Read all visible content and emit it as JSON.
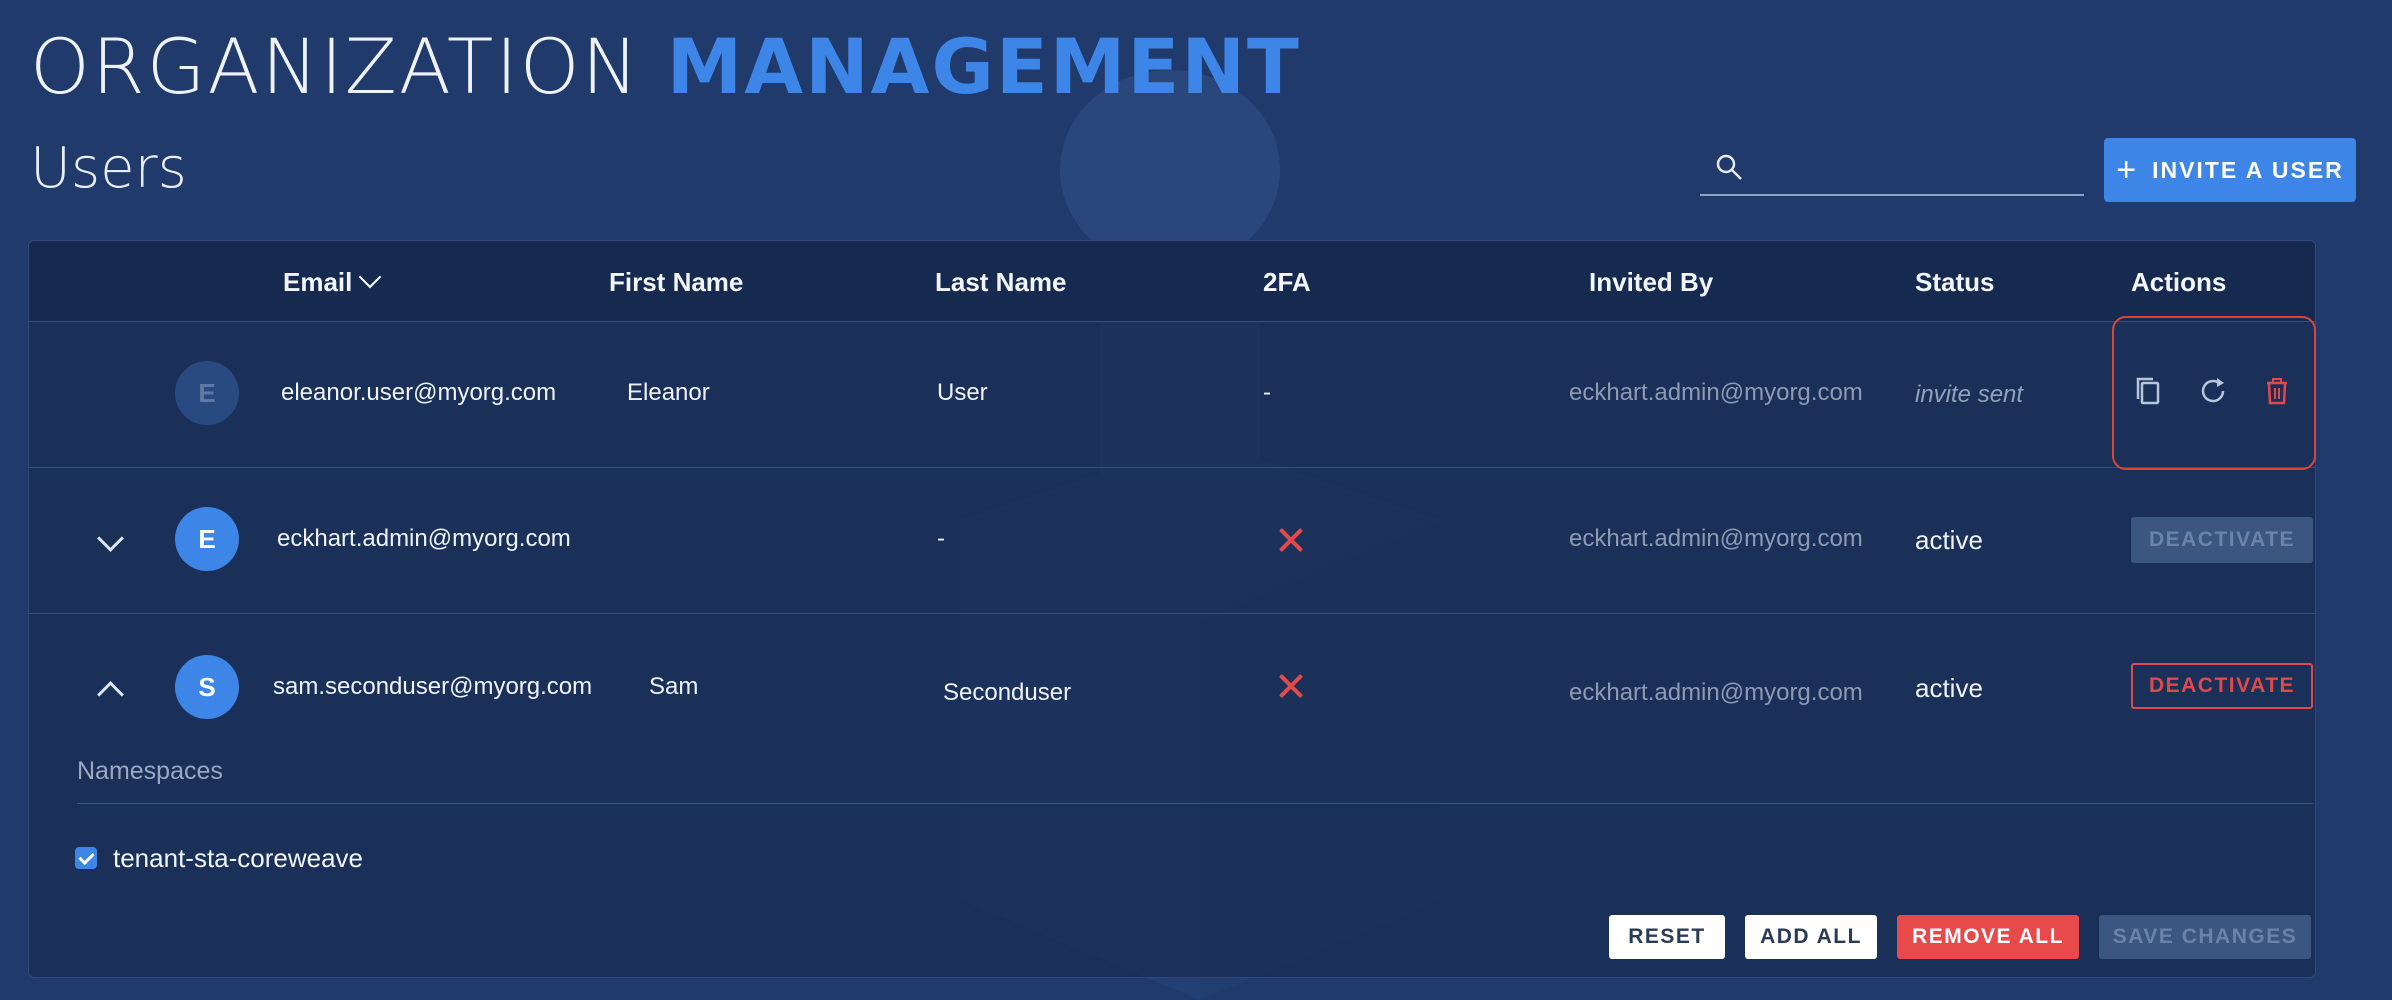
{
  "header": {
    "title_part1": "ORGANIZATION",
    "title_part2": "MANAGEMENT",
    "section_title": "Users"
  },
  "search": {
    "placeholder": "",
    "value": ""
  },
  "invite_button": {
    "label": "INVITE A USER",
    "icon": "plus-icon"
  },
  "table": {
    "columns": [
      "Email",
      "First Name",
      "Last Name",
      "2FA",
      "Invited By",
      "Status",
      "Actions"
    ],
    "sorted_column": "Email",
    "rows": [
      {
        "avatar": "E",
        "email": "eleanor.user@myorg.com",
        "first_name": "Eleanor",
        "last_name": "User",
        "twofa": "-",
        "invited_by": "eckhart.admin@myorg.com",
        "status": "invite sent",
        "actions": [
          "copy-icon",
          "refresh-icon",
          "trash-icon"
        ]
      },
      {
        "avatar": "E",
        "email": "eckhart.admin@myorg.com",
        "first_name": "",
        "last_name": "-",
        "twofa": "x-icon",
        "invited_by": "eckhart.admin@myorg.com",
        "status": "active",
        "action_label": "DEACTIVATE"
      },
      {
        "avatar": "S",
        "email": "sam.seconduser@myorg.com",
        "first_name": "Sam",
        "last_name": "Seconduser",
        "twofa": "x-icon",
        "invited_by": "eckhart.admin@myorg.com",
        "status": "active",
        "action_label": "DEACTIVATE"
      }
    ]
  },
  "namespaces": {
    "label": "Namespaces",
    "items": [
      {
        "name": "tenant-sta-coreweave",
        "checked": true
      }
    ],
    "buttons": {
      "reset": "RESET",
      "add_all": "ADD ALL",
      "remove_all": "REMOVE ALL",
      "save_changes": "SAVE CHANGES"
    }
  },
  "colors": {
    "background": "#1f3a6b",
    "accent": "#3d85e6",
    "danger": "#e8494b"
  }
}
